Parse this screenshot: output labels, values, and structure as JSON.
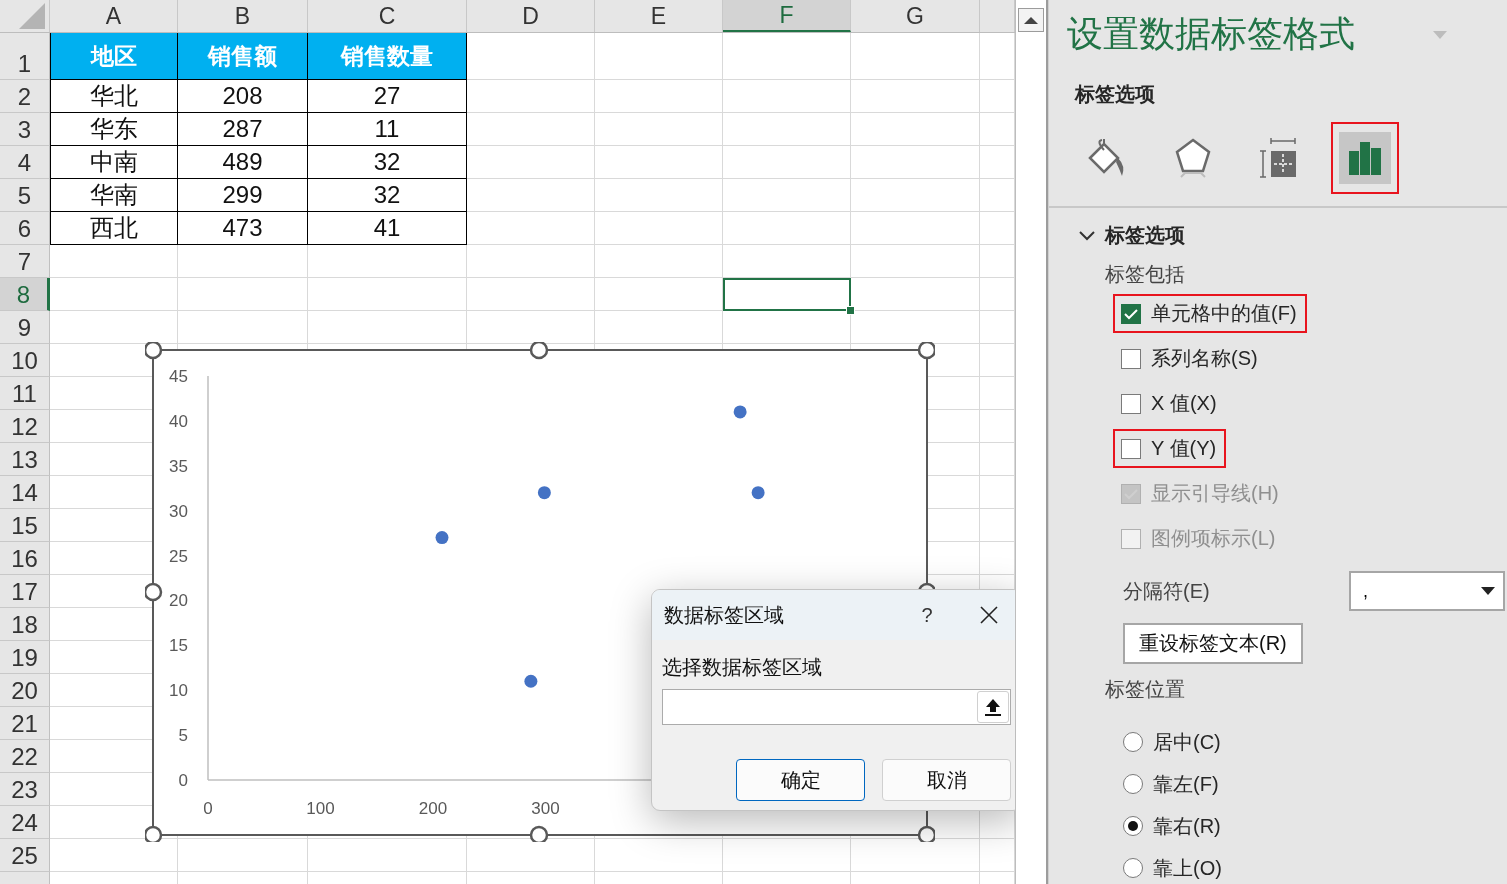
{
  "sheet": {
    "columns": [
      {
        "label": "A",
        "selected": false
      },
      {
        "label": "B",
        "selected": false
      },
      {
        "label": "C",
        "selected": false
      },
      {
        "label": "D",
        "selected": false
      },
      {
        "label": "E",
        "selected": false
      },
      {
        "label": "F",
        "selected": true
      },
      {
        "label": "G",
        "selected": false
      }
    ],
    "rows": [
      {
        "label": "1",
        "selected": false
      },
      {
        "label": "2",
        "selected": false
      },
      {
        "label": "3",
        "selected": false
      },
      {
        "label": "4",
        "selected": false
      },
      {
        "label": "5",
        "selected": false
      },
      {
        "label": "6",
        "selected": false
      },
      {
        "label": "7",
        "selected": false
      },
      {
        "label": "8",
        "selected": true
      },
      {
        "label": "9",
        "selected": false
      },
      {
        "label": "10",
        "selected": false
      },
      {
        "label": "11",
        "selected": false
      },
      {
        "label": "12",
        "selected": false
      },
      {
        "label": "13",
        "selected": false
      },
      {
        "label": "14",
        "selected": false
      },
      {
        "label": "15",
        "selected": false
      },
      {
        "label": "16",
        "selected": false
      },
      {
        "label": "17",
        "selected": false
      },
      {
        "label": "18",
        "selected": false
      },
      {
        "label": "19",
        "selected": false
      },
      {
        "label": "20",
        "selected": false
      },
      {
        "label": "21",
        "selected": false
      },
      {
        "label": "22",
        "selected": false
      },
      {
        "label": "23",
        "selected": false
      },
      {
        "label": "24",
        "selected": false
      },
      {
        "label": "25",
        "selected": false
      }
    ],
    "table": {
      "header": [
        "地区",
        "销售额",
        "销售数量"
      ],
      "rows": [
        [
          "华北",
          "208",
          "27"
        ],
        [
          "华东",
          "287",
          "11"
        ],
        [
          "中南",
          "489",
          "32"
        ],
        [
          "华南",
          "299",
          "32"
        ],
        [
          "西北",
          "473",
          "41"
        ]
      ]
    }
  },
  "chart": {
    "selected": true,
    "chart_data": {
      "type": "scatter",
      "x": [
        208,
        287,
        489,
        299,
        473
      ],
      "series": [
        {
          "color": "#4472c4",
          "values": [
            27,
            11,
            32,
            32,
            41
          ]
        }
      ],
      "xlim": [
        0,
        600
      ],
      "ylim": [
        0,
        45
      ],
      "xticks": [
        0,
        100,
        200,
        300
      ],
      "yticks": [
        0,
        5,
        10,
        15,
        20,
        25,
        30,
        35,
        40,
        45
      ]
    }
  },
  "dialog": {
    "title": "数据标签区域",
    "help": "?",
    "label": "选择数据标签区域",
    "buttons": [
      {
        "label": "确定",
        "default": true
      },
      {
        "label": "取消",
        "default": false
      }
    ]
  },
  "panel": {
    "title": "设置数据标签格式",
    "subtitle": "标签选项",
    "icon_tabs": [
      {
        "kind": "fill",
        "selected": false,
        "highlighted": false
      },
      {
        "kind": "effects",
        "selected": false,
        "highlighted": false
      },
      {
        "kind": "size",
        "selected": false,
        "highlighted": false
      },
      {
        "kind": "options",
        "selected": true,
        "highlighted": true
      }
    ],
    "section": {
      "title": "标签选项",
      "expanded": true,
      "include_label": "标签包括",
      "checkboxes": [
        {
          "label": "单元格中的值(F)",
          "checked": true,
          "disabled": false,
          "highlighted": true
        },
        {
          "label": "系列名称(S)",
          "checked": false,
          "disabled": false,
          "highlighted": false
        },
        {
          "label": "X 值(X)",
          "checked": false,
          "disabled": false,
          "highlighted": false
        },
        {
          "label": "Y 值(Y)",
          "checked": false,
          "disabled": false,
          "highlighted": true
        },
        {
          "label": "显示引导线(H)",
          "checked": true,
          "disabled": true,
          "highlighted": false
        },
        {
          "label": "图例项标示(L)",
          "checked": false,
          "disabled": true,
          "highlighted": false
        }
      ],
      "separator": {
        "label": "分隔符(E)",
        "value": ","
      },
      "reset_button": "重设标签文本(R)",
      "position_label": "标签位置",
      "positions": [
        {
          "label": "居中(C)",
          "selected": false
        },
        {
          "label": "靠左(F)",
          "selected": false
        },
        {
          "label": "靠右(R)",
          "selected": true
        },
        {
          "label": "靠上(O)",
          "selected": false
        }
      ]
    }
  }
}
